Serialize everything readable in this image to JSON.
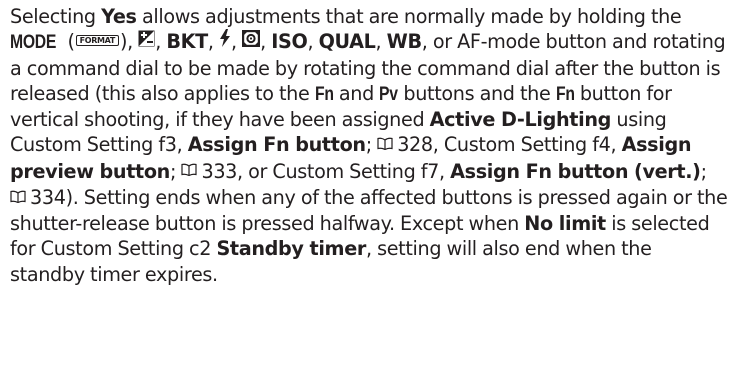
{
  "text": {
    "t01": "Selecting ",
    "b_yes": "Yes",
    "t02": " allows adjustments that are normally made by holding the ",
    "k_mode": "MODE",
    "t03": " (",
    "k_format": "FORMAT",
    "t04": "), ",
    "t05": ", ",
    "k_bkt": "BKT",
    "t06": ", ",
    "t07": ", ",
    "t08": ", ",
    "k_iso": "ISO",
    "t09": ", ",
    "k_qual": "QUAL",
    "t10": ", ",
    "k_wb": "WB",
    "t11": ", or AF-mode button and rotating a command dial to be made by rotating the command dial after the button is released (this also applies to the ",
    "k_fn1": "Fn",
    "t12": " and ",
    "k_pv": "Pv",
    "t13": " buttons and the ",
    "k_fn2": "Fn",
    "t14": " button for vertical shooting, if they have been assigned ",
    "b_adl": "Active D-Lighting",
    "t15": " using Custom Setting f3, ",
    "b_fn": "Assign Fn button",
    "t16": "; ",
    "p328": "328",
    "t17": ", Custom Setting f4, ",
    "b_preview": "Assign preview button",
    "t18": "; ",
    "p333": "333",
    "t19": ", or Custom Setting f7, ",
    "b_fnvert": "Assign Fn button (vert.)",
    "t20": "; ",
    "p334": "334",
    "t21": ").  Setting ends when any of the affected buttons is pressed again or the shutter-release button is pressed halfway.  Except when ",
    "b_nolimit": "No limit",
    "t22": " is selected for Custom Setting c2 ",
    "b_standby": "Standby timer",
    "t23": ", setting will also end when the standby timer expires."
  },
  "icons": [
    "format-button-icon",
    "exposure-compensation-icon",
    "flash-icon",
    "metering-icon",
    "book-reference-icon"
  ]
}
